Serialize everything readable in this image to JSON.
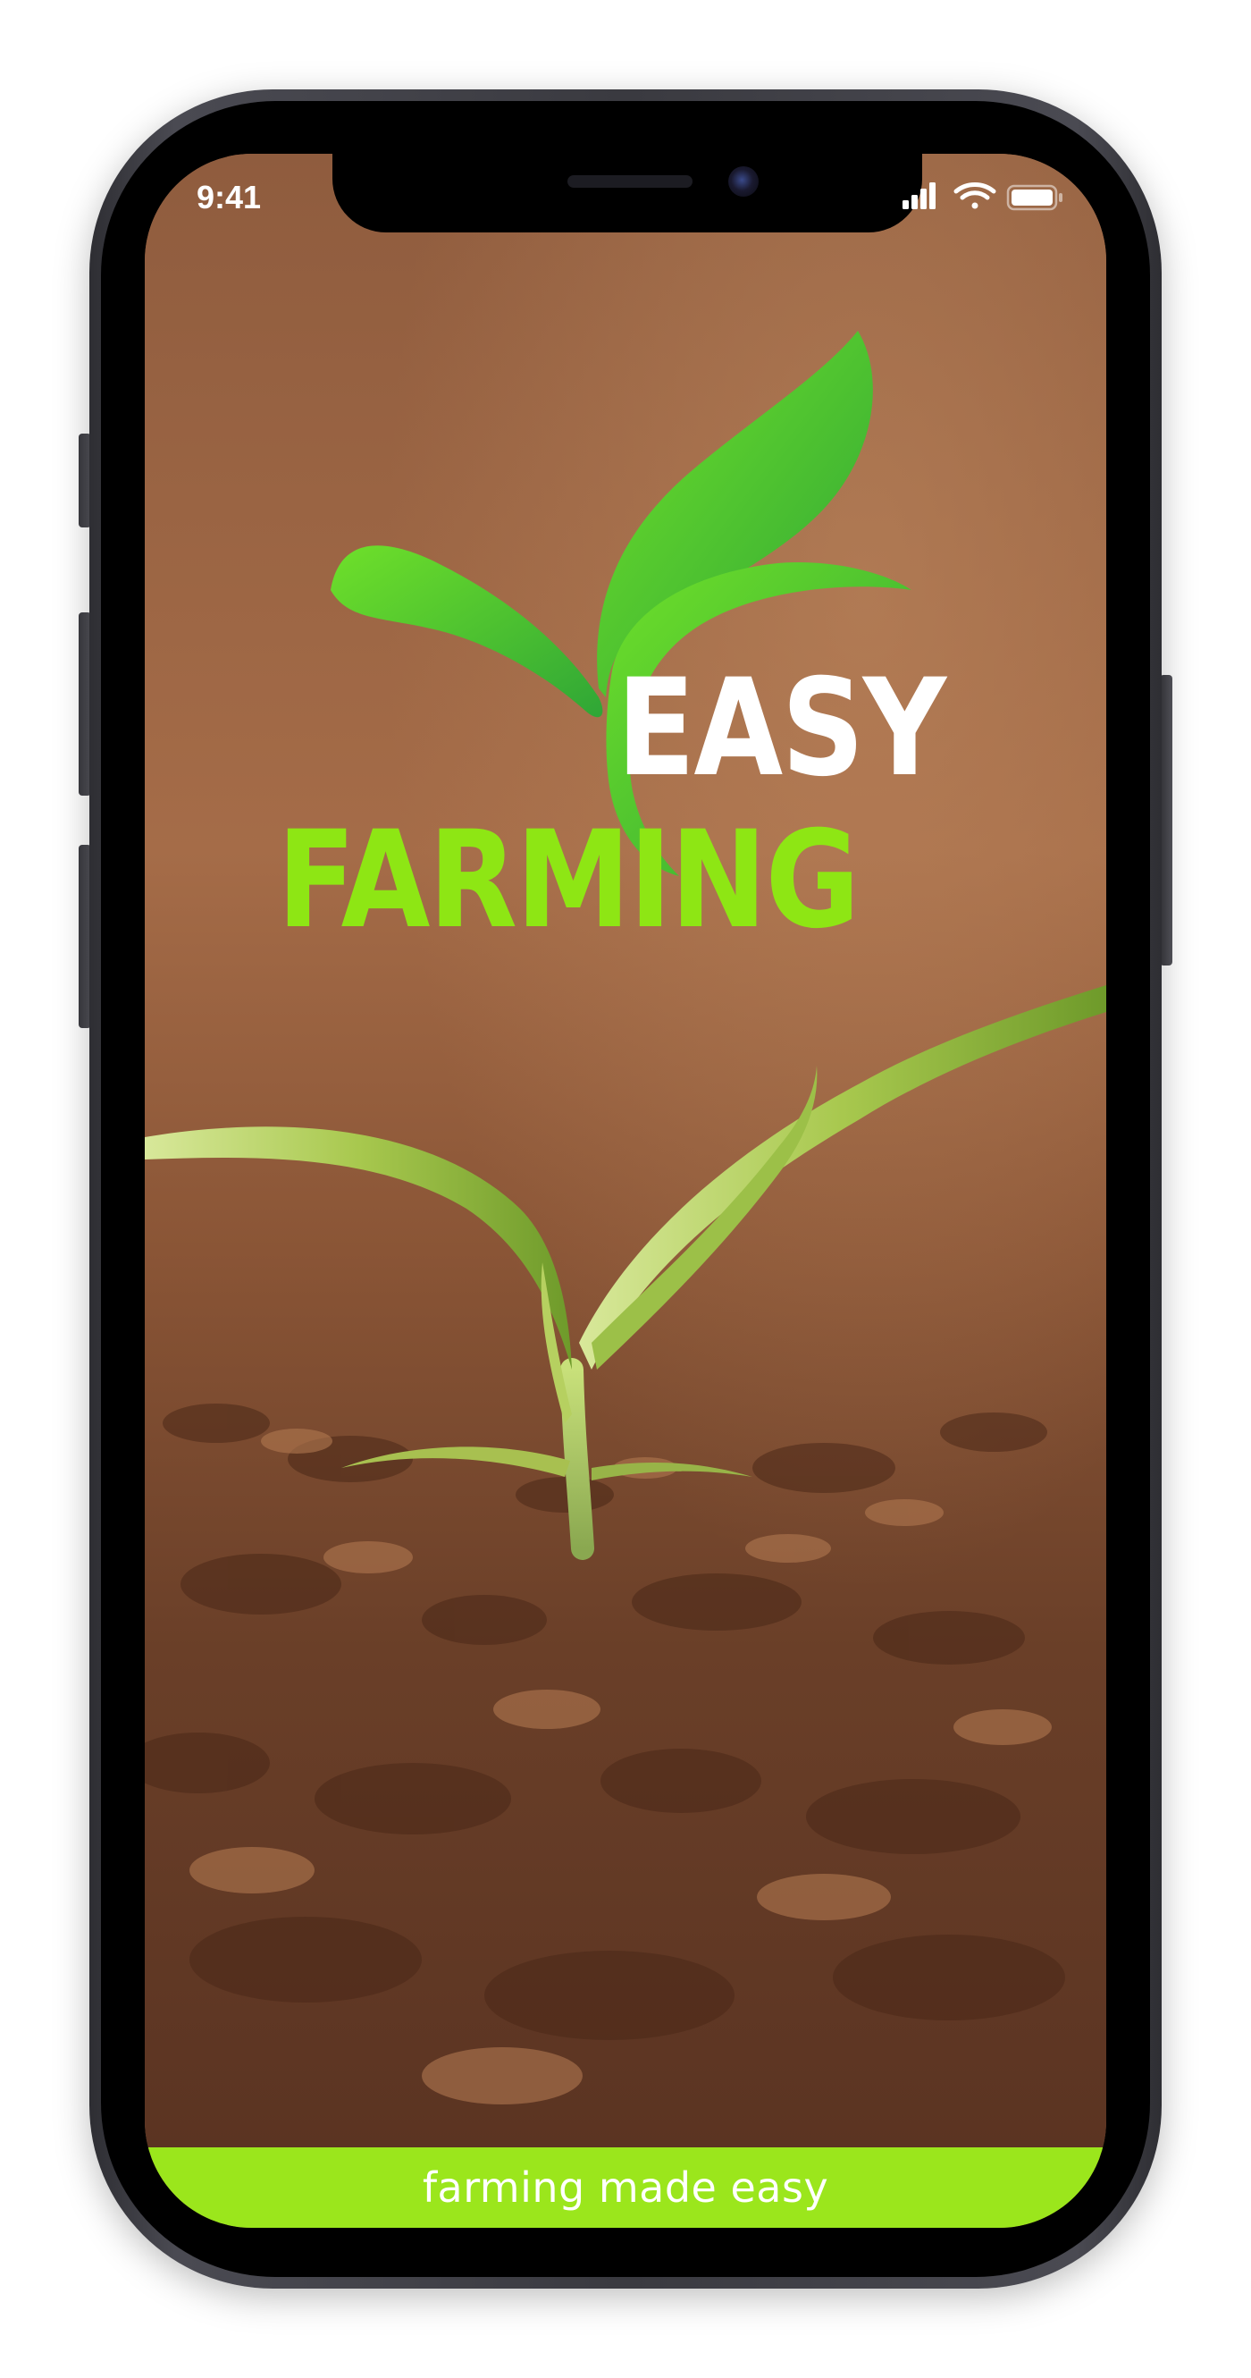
{
  "status_bar": {
    "time": "9:41",
    "icons": [
      "cellular-signal-icon",
      "wifi-icon",
      "battery-icon"
    ]
  },
  "brand": {
    "word1": "EASY",
    "word2": "FARMING",
    "logo_icon": "leaf-sprout-icon"
  },
  "footer": {
    "tagline": "farming made easy"
  },
  "colors": {
    "brand_green": "#8ee614",
    "footer_green": "#9be61c",
    "soil_brown": "#8a5a3c",
    "text_white": "#ffffff"
  }
}
